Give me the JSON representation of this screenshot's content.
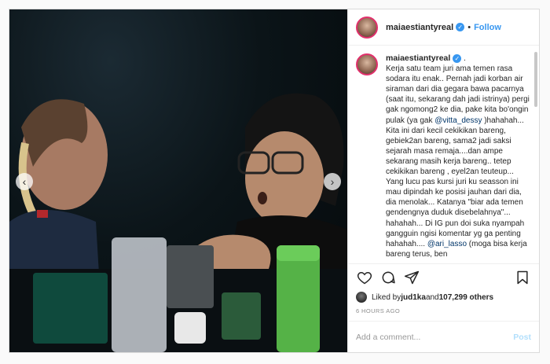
{
  "header": {
    "username": "maiaestiantyreal",
    "follow_label": "Follow"
  },
  "caption": {
    "username": "maiaestiantyreal",
    "lead": " .",
    "p1": "Kerja satu team juri ama temen rasa sodara itu enak.. Pernah jadi korban air siraman dari dia gegara bawa pacarnya (saat itu, sekarang dah jadi istrinya) pergi gak ngomong2 ke dia, pake kita bo'ongin pulak (ya gak ",
    "mention1": "@vitta_dessy",
    "p2": " )hahahah... Kita ini dari kecil cekikikan bareng, gebiek2an bareng, sama2 jadi saksi sejarah masa remaja....dan ampe sekarang masih kerja bareng.. tetep cekikikan bareng , eyel2an teuteup... Yang lucu pas kursi juri ku seasson ini mau dipindah ke posisi jauhan dari dia, dia menolak... Katanya \"biar ada temen gendengnya duduk disebelahnya\"... hahahah... Di IG pun doi suka nyampah gangguin ngisi komentar yg ga penting hahahah.... ",
    "mention2": "@ari_lasso",
    "p3": " (moga bisa kerja bareng terus, ben"
  },
  "likes": {
    "prefix": "Liked by ",
    "user": "jud1ka",
    "and": " and ",
    "count": "107,299 others"
  },
  "time_ago": "6 HOURS AGO",
  "comment": {
    "placeholder": "Add a comment...",
    "post_label": "Post"
  },
  "icons": {
    "like": "heart-icon",
    "comment": "comment-icon",
    "share": "share-icon",
    "save": "bookmark-icon"
  },
  "colors": {
    "link": "#3897f0",
    "verified": "#3897f0",
    "mention": "#003569"
  }
}
